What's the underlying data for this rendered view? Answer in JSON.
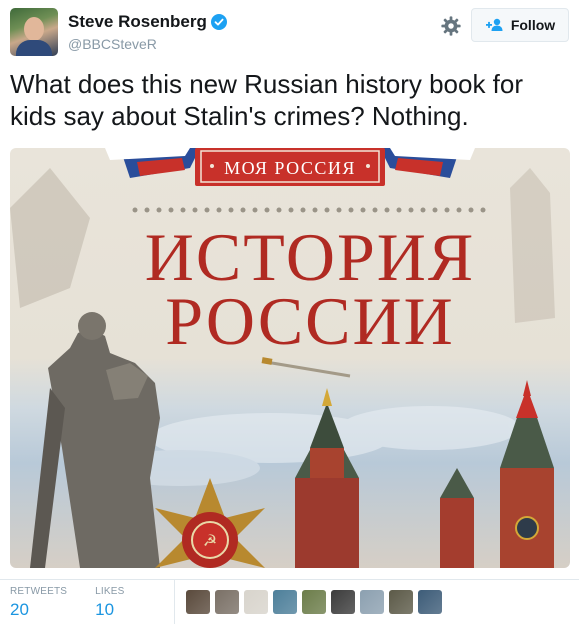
{
  "author": {
    "name": "Steve Rosenberg",
    "handle": "@BBCSteveR",
    "verified": true,
    "avatar_icon": "profile-photo"
  },
  "actions": {
    "follow_label": "Follow",
    "settings_icon": "gear-icon"
  },
  "tweet": {
    "text": "What does this new Russian history book for kids say about Stalin's crimes? Nothing."
  },
  "media": {
    "banner_text": "МОЯ РОССИЯ",
    "title_line1": "ИСТОРИЯ",
    "title_line2": "РОССИИ"
  },
  "stats": {
    "retweets_label": "RETWEETS",
    "retweets_value": "20",
    "likes_label": "LIKES",
    "likes_value": "10"
  },
  "likers": [
    {
      "color": "#5a4a3c"
    },
    {
      "color": "#7a7066"
    },
    {
      "color": "#d8d4cc"
    },
    {
      "color": "#4d7f9a"
    },
    {
      "color": "#6c7d4a"
    },
    {
      "color": "#3c3c3c"
    },
    {
      "color": "#8ca0b0"
    },
    {
      "color": "#5c5a48"
    },
    {
      "color": "#3d5c78"
    }
  ],
  "colors": {
    "accent": "#1b95e0",
    "muted": "#8899a6",
    "title_red": "#b02a22"
  }
}
